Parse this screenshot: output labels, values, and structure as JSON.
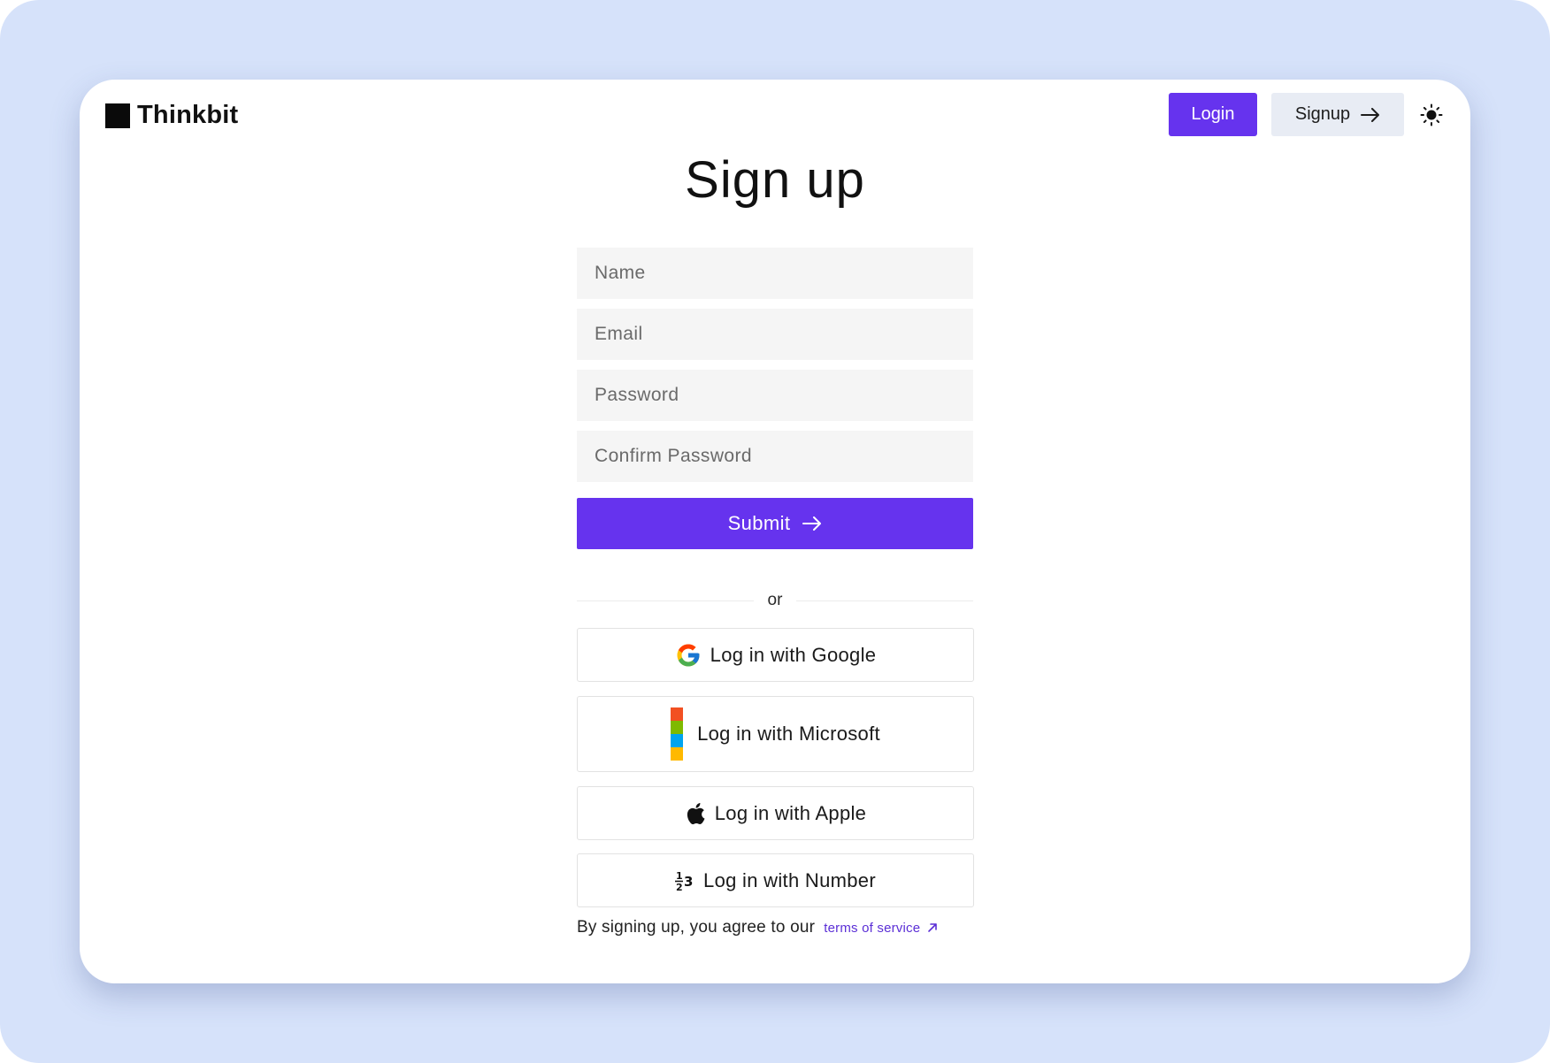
{
  "app": {
    "brand_name": "Thinkbit"
  },
  "header": {
    "login_label": "Login",
    "signup_label": "Signup",
    "theme_icon": "sun-icon"
  },
  "form": {
    "title": "Sign up",
    "name_placeholder": "Name",
    "email_placeholder": "Email",
    "password_placeholder": "Password",
    "confirm_placeholder": "Confirm Password",
    "submit_label": "Submit",
    "divider_text": "or"
  },
  "social": {
    "google_label": "Log in with Google",
    "microsoft_label": "Log in with Microsoft",
    "apple_label": "Log in with Apple",
    "number_label": "Log in with Number"
  },
  "footer": {
    "agree_text": "By signing up, you agree to our",
    "terms_label": "terms of service"
  },
  "colors": {
    "accent": "#6633ee",
    "backdrop": "#d6e2fa",
    "field_bg": "#f5f5f5",
    "link": "#5b2fd6",
    "microsoft": [
      "#f25022",
      "#7fba00",
      "#00a4ef",
      "#ffb900"
    ]
  }
}
